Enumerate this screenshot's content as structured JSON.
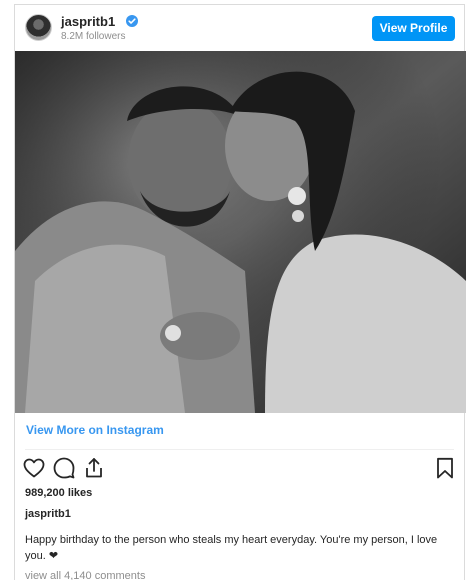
{
  "header": {
    "username": "jaspritb1",
    "verified_icon": "verified-badge-icon",
    "followers": "8.2M followers",
    "view_profile_label": "View Profile"
  },
  "post": {
    "view_more_label": "View More on Instagram",
    "likes": "989,200 likes",
    "caption_username": "jaspritb1",
    "caption_text": "Happy birthday to the person who steals my heart everyday. You're my person, I love you. ❤",
    "view_comments": "view all 4,140 comments"
  },
  "icons": {
    "like": "heart-outline-icon",
    "comment": "comment-bubble-icon",
    "share": "share-upload-icon",
    "save": "bookmark-icon"
  },
  "colors": {
    "accent": "#0095f6",
    "link": "#3897f0",
    "text": "#262626",
    "muted": "#8e8e8e",
    "border": "#dbdbdb"
  }
}
